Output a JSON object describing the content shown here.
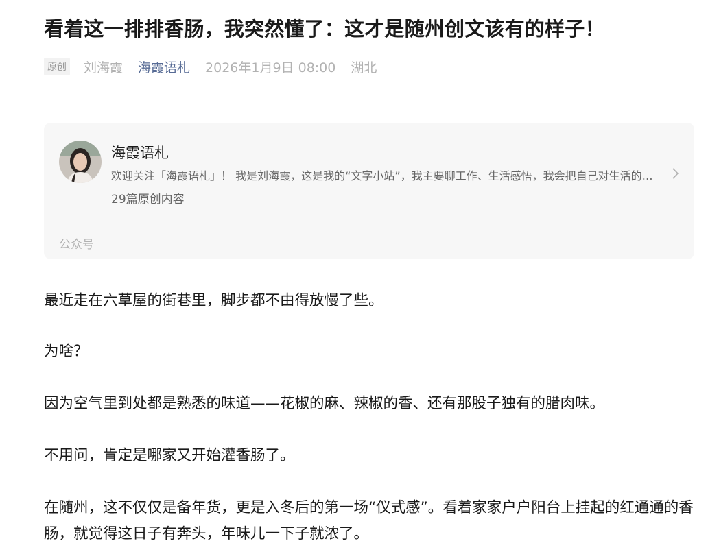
{
  "article": {
    "title": "看着这一排排香肠，我突然懂了：这才是随州创文该有的样子！",
    "original_badge": "原创",
    "author": "刘海霞",
    "account_name": "海霞语札",
    "publish_time": "2026年1月9日 08:00",
    "location": "湖北"
  },
  "profile_card": {
    "avatar_icon": "author-avatar",
    "name": "海霞语札",
    "description": "欢迎关注「海霞语札」！ 我是刘海霞，这是我的“文字小站”，我主要聊工作、生活感悟，我会把自己对生活的思考和感悟分享出来",
    "original_count": "29篇原创内容",
    "type_label": "公众号",
    "chevron_icon": "chevron-right-icon"
  },
  "paragraphs": [
    "最近走在六草屋的街巷里，脚步都不由得放慢了些。",
    "为啥？",
    "因为空气里到处都是熟悉的味道——花椒的麻、辣椒的香、还有那股子独有的腊肉味。",
    "不用问，肯定是哪家又开始灌香肠了。",
    "在随州，这不仅仅是备年货，更是入冬后的第一场“仪式感”。看着家家户户阳台上挂起的红通通的香肠，就觉得这日子有奔头，年味儿一下子就浓了。"
  ],
  "colors": {
    "link_blue": "#576b95",
    "card_bg": "#f7f7f7",
    "meta_gray": "#b2b2b2"
  }
}
